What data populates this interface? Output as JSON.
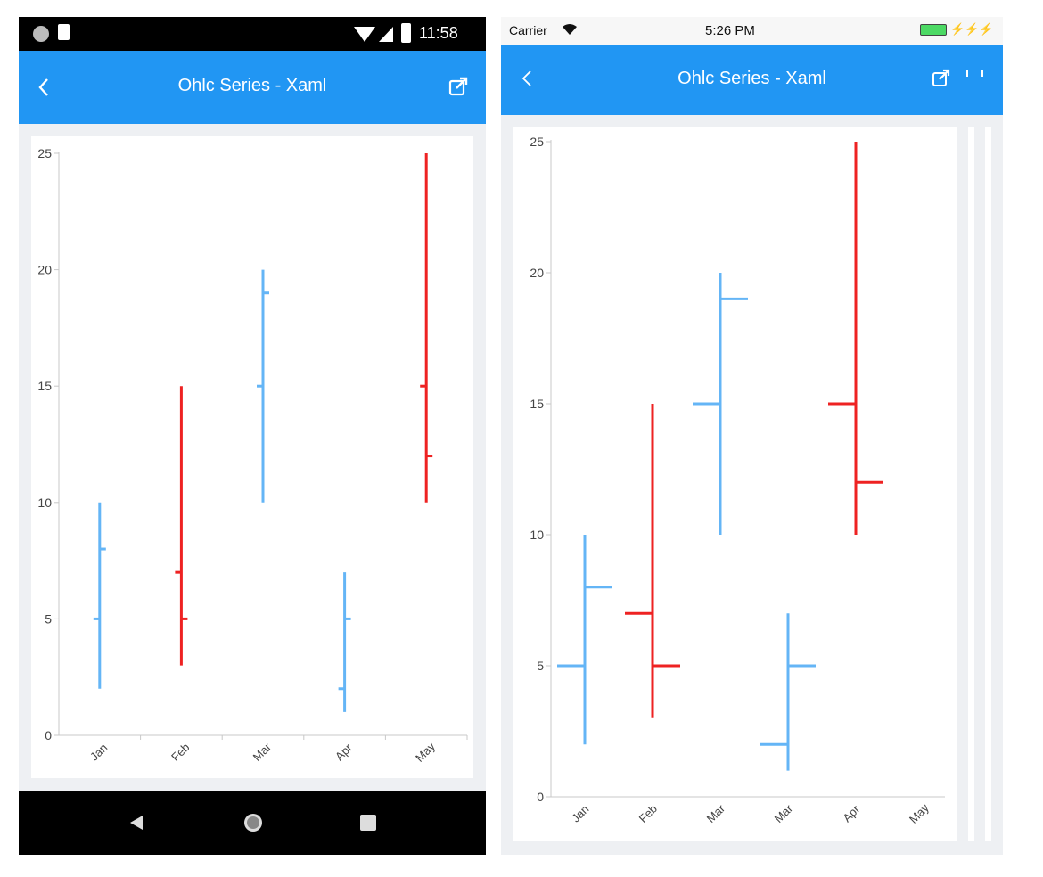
{
  "android": {
    "status": {
      "time": "11:58"
    },
    "appbar": {
      "title": "Ohlc Series - Xaml",
      "back_icon": "chevron-left-icon",
      "open_icon": "open-in-new-icon"
    },
    "nav": {
      "back_icon": "triangle-back-icon",
      "home_icon": "circle-home-icon",
      "recents_icon": "square-recents-icon"
    }
  },
  "ios": {
    "status": {
      "carrier": "Carrier",
      "time": "5:26 PM"
    },
    "appbar": {
      "title": "Ohlc Series - Xaml",
      "back_icon": "chevron-left-icon",
      "open_icon": "open-in-new-icon"
    }
  },
  "colors": {
    "bull": "#64b5f6",
    "bear": "#ee2222",
    "appbar": "#2196f3"
  },
  "chart_data": [
    {
      "type": "ohlc",
      "y_ticks": [
        "0",
        "5",
        "10",
        "15",
        "20",
        "25"
      ],
      "ylim": [
        0,
        25
      ],
      "categories": [
        "Jan",
        "Feb",
        "Mar",
        "Apr",
        "May"
      ],
      "points": [
        {
          "category": "Jan",
          "open": 5,
          "high": 10,
          "low": 2,
          "close": 8
        },
        {
          "category": "Feb",
          "open": 7,
          "high": 15,
          "low": 3,
          "close": 5
        },
        {
          "category": "Mar",
          "open": 15,
          "high": 20,
          "low": 10,
          "close": 19
        },
        {
          "category": "Apr",
          "open": 2,
          "high": 7,
          "low": 1,
          "close": 5
        },
        {
          "category": "May",
          "open": 15,
          "high": 25,
          "low": 10,
          "close": 12
        }
      ]
    },
    {
      "type": "ohlc",
      "y_ticks": [
        "0",
        "5",
        "10",
        "15",
        "20",
        "25"
      ],
      "ylim": [
        0,
        25
      ],
      "categories": [
        "Jan",
        "Feb",
        "Mar",
        "Mar",
        "Apr",
        "May"
      ],
      "points": [
        {
          "category": "Jan",
          "open": 5,
          "high": 10,
          "low": 2,
          "close": 8
        },
        {
          "category": "Feb",
          "open": 7,
          "high": 15,
          "low": 3,
          "close": 5
        },
        {
          "category": "Mar",
          "open": 15,
          "high": 20,
          "low": 10,
          "close": 19
        },
        {
          "category": "Mar",
          "open": 2,
          "high": 7,
          "low": 1,
          "close": 5
        },
        {
          "category": "Apr",
          "open": 15,
          "high": 25,
          "low": 10,
          "close": 12
        }
      ]
    }
  ]
}
